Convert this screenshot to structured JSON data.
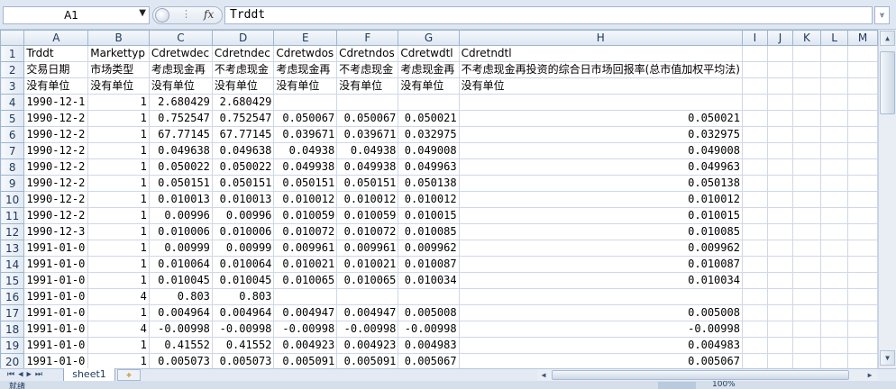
{
  "formula_bar": {
    "name_box": "A1",
    "fx_label": "fx",
    "value": "Trddt"
  },
  "columns": [
    "A",
    "B",
    "C",
    "D",
    "E",
    "F",
    "G",
    "H",
    "I",
    "J",
    "K",
    "L",
    "M"
  ],
  "rows": [
    {
      "n": "1",
      "a": "Trddt",
      "b": "Markettyp",
      "c": "Cdretwdec",
      "d": "Cdretndec",
      "e": "Cdretwdos",
      "f": "Cdretndos",
      "g": "Cdretwdtl",
      "h": "Cdretndtl"
    },
    {
      "n": "2",
      "a": "交易日期",
      "b": "市场类型",
      "c": "考虑现金再",
      "d": "不考虑现金",
      "e": "考虑现金再",
      "f": "不考虑现金",
      "g": "考虑现金再",
      "h": "不考虑现金再投资的综合日市场回报率(总市值加权平均法)"
    },
    {
      "n": "3",
      "a": "没有单位",
      "b": "没有单位",
      "c": "没有单位",
      "d": "没有单位",
      "e": "没有单位",
      "f": "没有单位",
      "g": "没有单位",
      "h": "没有单位"
    },
    {
      "n": "4",
      "a": "1990-12-1",
      "b": "1",
      "c": "2.680429",
      "d": "2.680429",
      "e": "",
      "f": "",
      "g": "",
      "h": ""
    },
    {
      "n": "5",
      "a": "1990-12-2",
      "b": "1",
      "c": "0.752547",
      "d": "0.752547",
      "e": "0.050067",
      "f": "0.050067",
      "g": "0.050021",
      "h": "0.050021"
    },
    {
      "n": "6",
      "a": "1990-12-2",
      "b": "1",
      "c": "67.77145",
      "d": "67.77145",
      "e": "0.039671",
      "f": "0.039671",
      "g": "0.032975",
      "h": "0.032975"
    },
    {
      "n": "7",
      "a": "1990-12-2",
      "b": "1",
      "c": "0.049638",
      "d": "0.049638",
      "e": "0.04938",
      "f": "0.04938",
      "g": "0.049008",
      "h": "0.049008"
    },
    {
      "n": "8",
      "a": "1990-12-2",
      "b": "1",
      "c": "0.050022",
      "d": "0.050022",
      "e": "0.049938",
      "f": "0.049938",
      "g": "0.049963",
      "h": "0.049963"
    },
    {
      "n": "9",
      "a": "1990-12-2",
      "b": "1",
      "c": "0.050151",
      "d": "0.050151",
      "e": "0.050151",
      "f": "0.050151",
      "g": "0.050138",
      "h": "0.050138"
    },
    {
      "n": "10",
      "a": "1990-12-2",
      "b": "1",
      "c": "0.010013",
      "d": "0.010013",
      "e": "0.010012",
      "f": "0.010012",
      "g": "0.010012",
      "h": "0.010012"
    },
    {
      "n": "11",
      "a": "1990-12-2",
      "b": "1",
      "c": "0.00996",
      "d": "0.00996",
      "e": "0.010059",
      "f": "0.010059",
      "g": "0.010015",
      "h": "0.010015"
    },
    {
      "n": "12",
      "a": "1990-12-3",
      "b": "1",
      "c": "0.010006",
      "d": "0.010006",
      "e": "0.010072",
      "f": "0.010072",
      "g": "0.010085",
      "h": "0.010085"
    },
    {
      "n": "13",
      "a": "1991-01-0",
      "b": "1",
      "c": "0.00999",
      "d": "0.00999",
      "e": "0.009961",
      "f": "0.009961",
      "g": "0.009962",
      "h": "0.009962"
    },
    {
      "n": "14",
      "a": "1991-01-0",
      "b": "1",
      "c": "0.010064",
      "d": "0.010064",
      "e": "0.010021",
      "f": "0.010021",
      "g": "0.010087",
      "h": "0.010087"
    },
    {
      "n": "15",
      "a": "1991-01-0",
      "b": "1",
      "c": "0.010045",
      "d": "0.010045",
      "e": "0.010065",
      "f": "0.010065",
      "g": "0.010034",
      "h": "0.010034"
    },
    {
      "n": "16",
      "a": "1991-01-0",
      "b": "4",
      "c": "0.803",
      "d": "0.803",
      "e": "",
      "f": "",
      "g": "",
      "h": ""
    },
    {
      "n": "17",
      "a": "1991-01-0",
      "b": "1",
      "c": "0.004964",
      "d": "0.004964",
      "e": "0.004947",
      "f": "0.004947",
      "g": "0.005008",
      "h": "0.005008"
    },
    {
      "n": "18",
      "a": "1991-01-0",
      "b": "4",
      "c": "-0.00998",
      "d": "-0.00998",
      "e": "-0.00998",
      "f": "-0.00998",
      "g": "-0.00998",
      "h": "-0.00998"
    },
    {
      "n": "19",
      "a": "1991-01-0",
      "b": "1",
      "c": "0.41552",
      "d": "0.41552",
      "e": "0.004923",
      "f": "0.004923",
      "g": "0.004983",
      "h": "0.004983"
    },
    {
      "n": "20",
      "a": "1991-01-0",
      "b": "1",
      "c": "0.005073",
      "d": "0.005073",
      "e": "0.005091",
      "f": "0.005091",
      "g": "0.005067",
      "h": "0.005067"
    }
  ],
  "sheet_tabs": [
    "sheet1"
  ],
  "status": {
    "ready": "就绪",
    "zoom": "100%"
  }
}
